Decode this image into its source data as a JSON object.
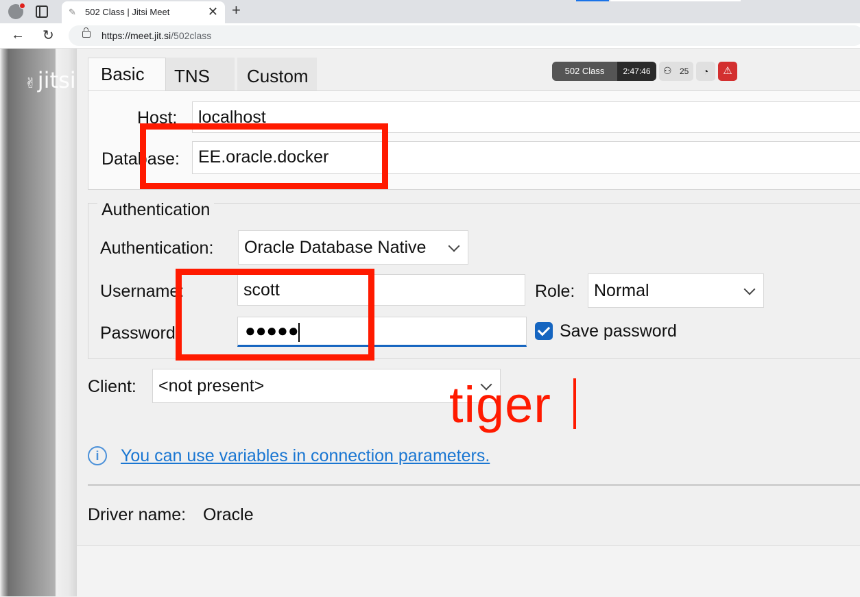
{
  "browser": {
    "tab_title": "502 Class | Jitsi Meet",
    "url_host": "https://meet.jit.si",
    "url_path": "/502class"
  },
  "jitsi": {
    "logo_text": "jitsi"
  },
  "meeting": {
    "name": "502 Class",
    "timer": "2:47:46",
    "participants": "25"
  },
  "dialog": {
    "tabs": [
      "Basic",
      "TNS",
      "Custom"
    ],
    "host_label": "Host:",
    "host_value": "localhost",
    "database_label": "Database:",
    "database_value": "EE.oracle.docker",
    "auth_group_title": "Authentication",
    "auth_label": "Authentication:",
    "auth_value": "Oracle Database Native",
    "username_label": "Username:",
    "username_value": "scott",
    "role_label": "Role:",
    "role_value": "Normal",
    "password_label": "Password:",
    "password_dots": "●●●●●",
    "save_password_label": "Save password",
    "save_password_checked": true,
    "client_label": "Client:",
    "client_value": "<not present>",
    "info_link": "You can use variables in connection parameters.",
    "driver_label": "Driver name:",
    "driver_value": "Oracle"
  },
  "annotation": {
    "handwritten": "tiger",
    "color": "#ff1a00"
  }
}
